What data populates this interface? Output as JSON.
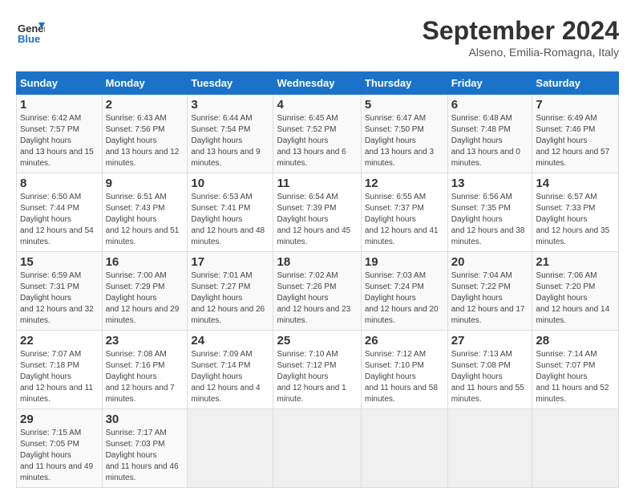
{
  "header": {
    "logo_line1": "General",
    "logo_line2": "Blue",
    "month": "September 2024",
    "location": "Alseno, Emilia-Romagna, Italy"
  },
  "columns": [
    "Sunday",
    "Monday",
    "Tuesday",
    "Wednesday",
    "Thursday",
    "Friday",
    "Saturday"
  ],
  "weeks": [
    [
      {
        "day": "1",
        "sunrise": "6:42 AM",
        "sunset": "7:57 PM",
        "daylight": "13 hours and 15 minutes."
      },
      {
        "day": "2",
        "sunrise": "6:43 AM",
        "sunset": "7:56 PM",
        "daylight": "13 hours and 12 minutes."
      },
      {
        "day": "3",
        "sunrise": "6:44 AM",
        "sunset": "7:54 PM",
        "daylight": "13 hours and 9 minutes."
      },
      {
        "day": "4",
        "sunrise": "6:45 AM",
        "sunset": "7:52 PM",
        "daylight": "13 hours and 6 minutes."
      },
      {
        "day": "5",
        "sunrise": "6:47 AM",
        "sunset": "7:50 PM",
        "daylight": "13 hours and 3 minutes."
      },
      {
        "day": "6",
        "sunrise": "6:48 AM",
        "sunset": "7:48 PM",
        "daylight": "13 hours and 0 minutes."
      },
      {
        "day": "7",
        "sunrise": "6:49 AM",
        "sunset": "7:46 PM",
        "daylight": "12 hours and 57 minutes."
      }
    ],
    [
      {
        "day": "8",
        "sunrise": "6:50 AM",
        "sunset": "7:44 PM",
        "daylight": "12 hours and 54 minutes."
      },
      {
        "day": "9",
        "sunrise": "6:51 AM",
        "sunset": "7:43 PM",
        "daylight": "12 hours and 51 minutes."
      },
      {
        "day": "10",
        "sunrise": "6:53 AM",
        "sunset": "7:41 PM",
        "daylight": "12 hours and 48 minutes."
      },
      {
        "day": "11",
        "sunrise": "6:54 AM",
        "sunset": "7:39 PM",
        "daylight": "12 hours and 45 minutes."
      },
      {
        "day": "12",
        "sunrise": "6:55 AM",
        "sunset": "7:37 PM",
        "daylight": "12 hours and 41 minutes."
      },
      {
        "day": "13",
        "sunrise": "6:56 AM",
        "sunset": "7:35 PM",
        "daylight": "12 hours and 38 minutes."
      },
      {
        "day": "14",
        "sunrise": "6:57 AM",
        "sunset": "7:33 PM",
        "daylight": "12 hours and 35 minutes."
      }
    ],
    [
      {
        "day": "15",
        "sunrise": "6:59 AM",
        "sunset": "7:31 PM",
        "daylight": "12 hours and 32 minutes."
      },
      {
        "day": "16",
        "sunrise": "7:00 AM",
        "sunset": "7:29 PM",
        "daylight": "12 hours and 29 minutes."
      },
      {
        "day": "17",
        "sunrise": "7:01 AM",
        "sunset": "7:27 PM",
        "daylight": "12 hours and 26 minutes."
      },
      {
        "day": "18",
        "sunrise": "7:02 AM",
        "sunset": "7:26 PM",
        "daylight": "12 hours and 23 minutes."
      },
      {
        "day": "19",
        "sunrise": "7:03 AM",
        "sunset": "7:24 PM",
        "daylight": "12 hours and 20 minutes."
      },
      {
        "day": "20",
        "sunrise": "7:04 AM",
        "sunset": "7:22 PM",
        "daylight": "12 hours and 17 minutes."
      },
      {
        "day": "21",
        "sunrise": "7:06 AM",
        "sunset": "7:20 PM",
        "daylight": "12 hours and 14 minutes."
      }
    ],
    [
      {
        "day": "22",
        "sunrise": "7:07 AM",
        "sunset": "7:18 PM",
        "daylight": "12 hours and 11 minutes."
      },
      {
        "day": "23",
        "sunrise": "7:08 AM",
        "sunset": "7:16 PM",
        "daylight": "12 hours and 7 minutes."
      },
      {
        "day": "24",
        "sunrise": "7:09 AM",
        "sunset": "7:14 PM",
        "daylight": "12 hours and 4 minutes."
      },
      {
        "day": "25",
        "sunrise": "7:10 AM",
        "sunset": "7:12 PM",
        "daylight": "12 hours and 1 minute."
      },
      {
        "day": "26",
        "sunrise": "7:12 AM",
        "sunset": "7:10 PM",
        "daylight": "11 hours and 58 minutes."
      },
      {
        "day": "27",
        "sunrise": "7:13 AM",
        "sunset": "7:08 PM",
        "daylight": "11 hours and 55 minutes."
      },
      {
        "day": "28",
        "sunrise": "7:14 AM",
        "sunset": "7:07 PM",
        "daylight": "11 hours and 52 minutes."
      }
    ],
    [
      {
        "day": "29",
        "sunrise": "7:15 AM",
        "sunset": "7:05 PM",
        "daylight": "11 hours and 49 minutes."
      },
      {
        "day": "30",
        "sunrise": "7:17 AM",
        "sunset": "7:03 PM",
        "daylight": "11 hours and 46 minutes."
      },
      null,
      null,
      null,
      null,
      null
    ]
  ]
}
